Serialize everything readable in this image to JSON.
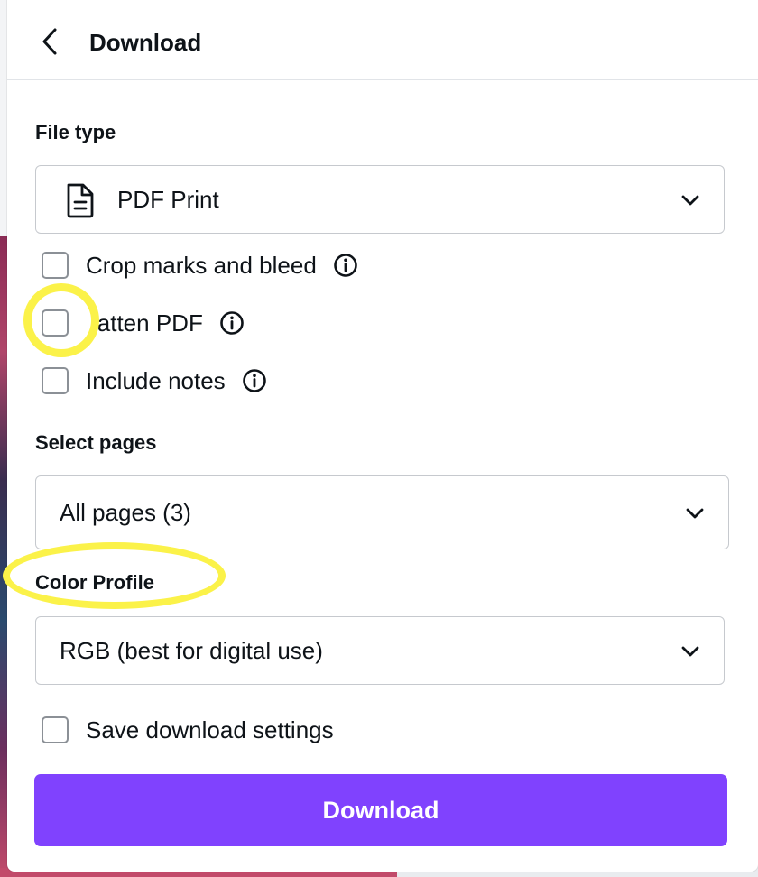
{
  "header": {
    "title": "Download"
  },
  "file_type": {
    "label": "File type",
    "value": "PDF Print",
    "icon": "file-document-icon"
  },
  "options": [
    {
      "label": "Crop marks and bleed",
      "checked": false,
      "has_info": true
    },
    {
      "label": "latten PDF",
      "checked": false,
      "has_info": true
    },
    {
      "label": "Include notes",
      "checked": false,
      "has_info": true
    }
  ],
  "select_pages": {
    "label": "Select pages",
    "value": "All pages (3)"
  },
  "color_profile": {
    "label": "Color Profile",
    "value": "RGB (best for digital use)"
  },
  "save_settings": {
    "label": "Save download settings",
    "checked": false
  },
  "download_button": {
    "label": "Download"
  },
  "colors": {
    "accent": "#8042fe",
    "highlight": "#fbf249",
    "text": "#0e1318",
    "border": "#c6c9ce"
  }
}
